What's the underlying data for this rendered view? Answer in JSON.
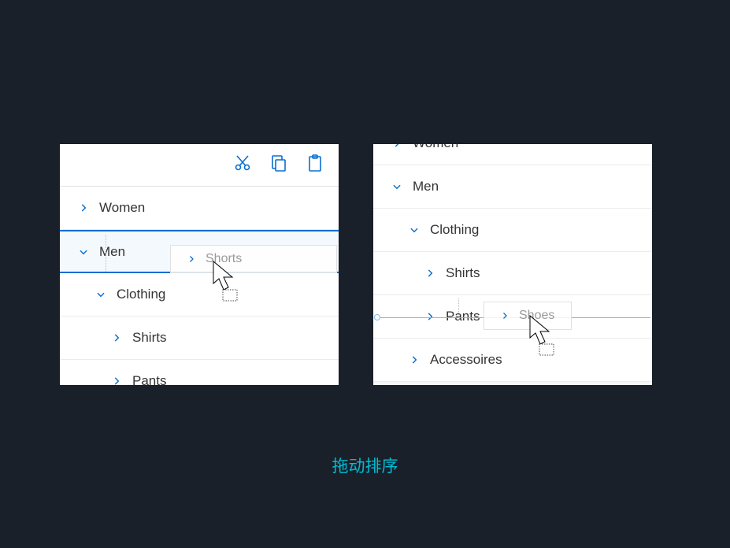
{
  "caption": "拖动排序",
  "toolbar": {
    "cut_icon": "cut",
    "copy_icon": "copy",
    "paste_icon": "paste"
  },
  "panel_a": {
    "rows": [
      {
        "label": "Women",
        "indent": 0,
        "expanded": false,
        "selected": false
      },
      {
        "label": "Men",
        "indent": 0,
        "expanded": true,
        "selected": true
      },
      {
        "label": "Clothing",
        "indent": 1,
        "expanded": true,
        "selected": false
      },
      {
        "label": "Shirts",
        "indent": 2,
        "expanded": false,
        "selected": false
      },
      {
        "label": "Pants",
        "indent": 2,
        "expanded": false,
        "selected": false
      }
    ],
    "drag_ghost": {
      "label": "Shorts"
    }
  },
  "panel_b": {
    "rows": [
      {
        "label": "Women",
        "indent": 0,
        "expanded": false,
        "selected": false
      },
      {
        "label": "Men",
        "indent": 0,
        "expanded": true,
        "selected": false
      },
      {
        "label": "Clothing",
        "indent": 1,
        "expanded": true,
        "selected": false
      },
      {
        "label": "Shirts",
        "indent": 2,
        "expanded": false,
        "selected": false
      },
      {
        "label": "Pants",
        "indent": 2,
        "expanded": false,
        "selected": false
      },
      {
        "label": "Accessoires",
        "indent": 1,
        "expanded": false,
        "selected": false
      }
    ],
    "drag_ghost": {
      "label": "Shoes"
    }
  }
}
